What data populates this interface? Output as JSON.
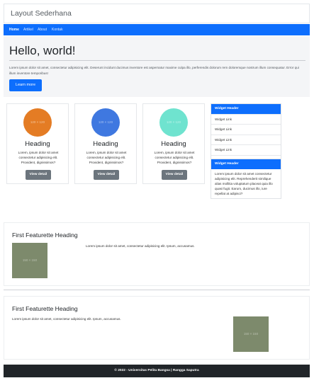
{
  "brand": "Layout Sederhana",
  "nav": {
    "items": [
      "Home",
      "Artikel",
      "About",
      "Kontak"
    ]
  },
  "jumbotron": {
    "title": "Hello, world!",
    "text": "Lorem ipsum dolor sit amet, consectetur adipisicing elit. Deserunt incidunt ducimus inventore est aspernatur maxime culpa illo, perferendis dolorum rem doloremque nostrum illum consequatur. Error qui illum inventore temporibus!",
    "button": "Learn more"
  },
  "cards": [
    {
      "image_label": "120 × 120",
      "heading": "Heading",
      "text": "Lorem, ipsum dolor sit amet consectetur adipisicing elit. Provident, dignissimos?",
      "button": "View detail",
      "color": "#e47c24"
    },
    {
      "image_label": "120 × 120",
      "heading": "Heading",
      "text": "Lorem, ipsum dolor sit amet consectetur adipisicing elit. Provident, dignissimos?",
      "button": "View detail",
      "color": "#3f78e0"
    },
    {
      "image_label": "120 × 120",
      "heading": "Heading",
      "text": "Lorem, ipsum dolor sit amet consectetur adipisicing elit. Provident, dignissimos?",
      "button": "View detail",
      "color": "#6fe3cf"
    }
  ],
  "widgets": {
    "first": {
      "header": "Widget Header",
      "links": [
        "Widget Link",
        "Widget Link",
        "Widget Link",
        "Widget Link",
        "Widget Link"
      ]
    },
    "second": {
      "header": "Widget Header",
      "body": "Lorem ipsum dolor sit amet consectetur adipisicing elit. Reprehenderit similique alias mollitia voluptatum placeat quia illo quasi fugit. Earum, ducimus illo, iure repellat at adipisci?"
    }
  },
  "featurettes": [
    {
      "heading": "First Featurette Heading",
      "text": "Lorem ipsum dolor sit amet, consectetur adipisicing elit. Ipsum, accusamus.",
      "image_label": "150 × 150"
    },
    {
      "heading": "First Featurette Heading",
      "text": "Lorem ipsum dolor sit amet, consectetur adipisicing elit. Ipsum, accusamus.",
      "image_label": "150 × 150"
    }
  ],
  "footer": "© 2022 - Universitas Pelita Bangsa | Rangga Saputra"
}
